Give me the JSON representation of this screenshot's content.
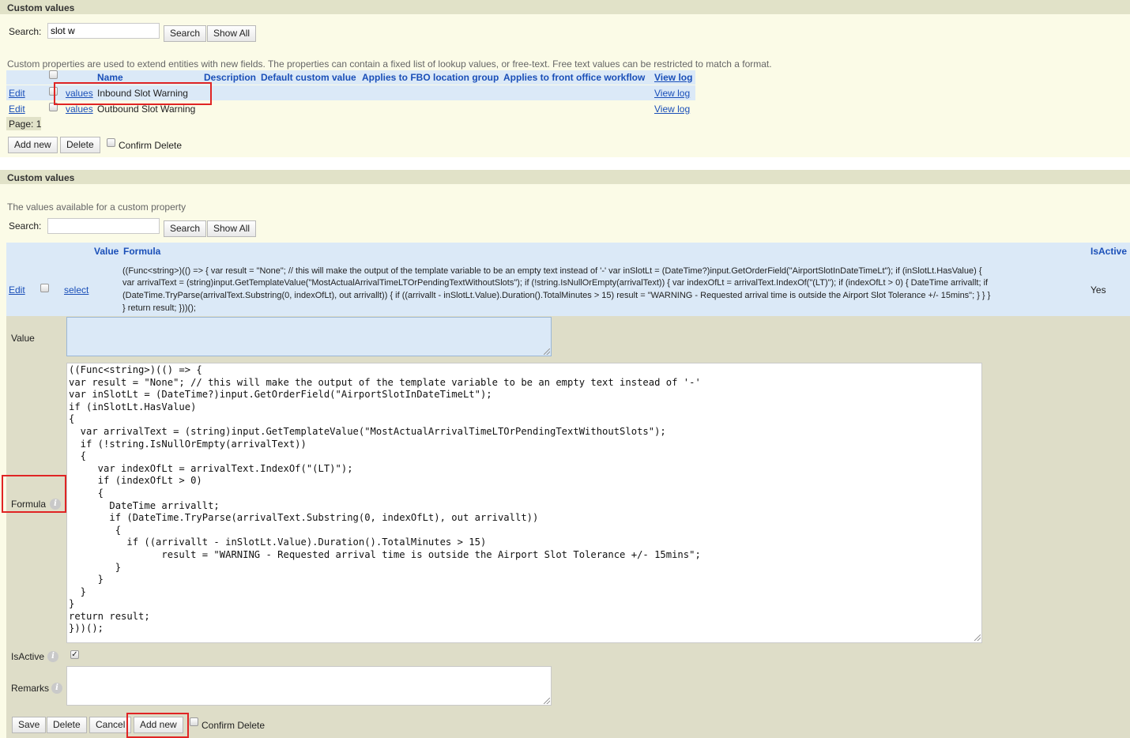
{
  "top_panel": {
    "title": "Custom values",
    "search_label": "Search:",
    "search_value": "slot w",
    "search_button": "Search",
    "show_all_button": "Show All",
    "description": "Custom properties are used to extend entities with new fields. The properties can contain a fixed list of lookup values, or free-text. Free text values can be restricted to match a format.",
    "columns": {
      "name": "Name",
      "description": "Description",
      "default_custom_value": "Default custom value",
      "applies_fbo": "Applies to FBO location group",
      "applies_workflow": "Applies to front office workflow",
      "view_log": "View log"
    },
    "rows": [
      {
        "edit": "Edit",
        "values": "values",
        "name": "Inbound Slot Warning",
        "view_log": "View log"
      },
      {
        "edit": "Edit",
        "values": "values",
        "name": "Outbound Slot Warning",
        "view_log": "View log"
      }
    ],
    "page_label": "Page: 1",
    "add_new_button": "Add new",
    "delete_button": "Delete",
    "confirm_delete": "Confirm Delete"
  },
  "values_panel": {
    "title": "Custom values",
    "subtitle": "The values available for a custom property",
    "search_label": "Search:",
    "search_value": "",
    "search_button": "Search",
    "show_all_button": "Show All",
    "columns": {
      "value": "Value",
      "formula": "Formula",
      "is_active": "IsActive"
    },
    "row": {
      "edit": "Edit",
      "select": "select",
      "formula_preview_lines": [
        "((Func<string>)(() => { var result = \"None\"; // this will make the output of the template variable to be an empty text instead of '-' var inSlotLt = (DateTime?)input.GetOrderField(\"AirportSlotInDateTimeLt\"); if (inSlotLt.HasValue) {",
        "var arrivalText = (string)input.GetTemplateValue(\"MostActualArrivalTimeLTOrPendingTextWithoutSlots\"); if (!string.IsNullOrEmpty(arrivalText)) { var indexOfLt = arrivalText.IndexOf(\"(LT)\"); if (indexOfLt > 0) { DateTime arrivallt; if",
        "(DateTime.TryParse(arrivalText.Substring(0, indexOfLt), out arrivallt)) { if ((arrivallt - inSlotLt.Value).Duration().TotalMinutes > 15) result = \"WARNING - Requested arrival time is outside the Airport Slot Tolerance +/- 15mins\"; } } }",
        "} return result; }))();"
      ],
      "is_active": "Yes"
    },
    "form": {
      "value_label": "Value",
      "value_text": "",
      "formula_label": "Formula",
      "formula_code": "((Func<string>)(() => {\nvar result = \"None\"; // this will make the output of the template variable to be an empty text instead of '-'\nvar inSlotLt = (DateTime?)input.GetOrderField(\"AirportSlotInDateTimeLt\");\nif (inSlotLt.HasValue)\n{\n  var arrivalText = (string)input.GetTemplateValue(\"MostActualArrivalTimeLTOrPendingTextWithoutSlots\");\n  if (!string.IsNullOrEmpty(arrivalText))\n  {\n     var indexOfLt = arrivalText.IndexOf(\"(LT)\");\n     if (indexOfLt > 0)\n     {\n       DateTime arrivallt;\n       if (DateTime.TryParse(arrivalText.Substring(0, indexOfLt), out arrivallt))\n        {\n          if ((arrivallt - inSlotLt.Value).Duration().TotalMinutes > 15)\n                result = \"WARNING - Requested arrival time is outside the Airport Slot Tolerance +/- 15mins\";\n        }\n     }\n  }\n}\nreturn result;\n}))();",
      "is_active_label": "IsActive",
      "remarks_label": "Remarks",
      "remarks_text": "",
      "save_button": "Save",
      "delete_button": "Delete",
      "cancel_button": "Cancel",
      "add_new_button": "Add new",
      "confirm_delete": "Confirm Delete"
    }
  },
  "colors": {
    "panel_bg": "#fbfbe7",
    "panel_header": "#e1e2c8",
    "header_row": "#dbe9f7",
    "link": "#1a4fb8",
    "form_bg": "#deddc8",
    "highlight": "#e02424"
  }
}
